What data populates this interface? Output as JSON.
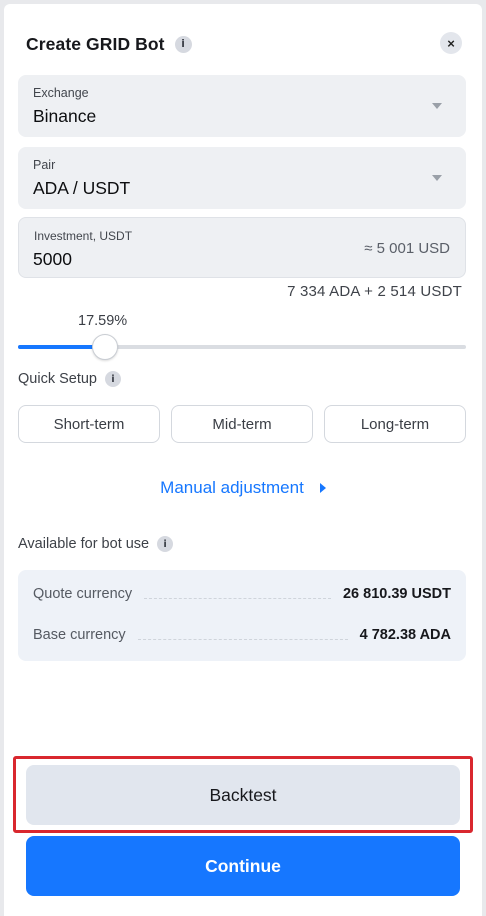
{
  "header": {
    "title": "Create GRID Bot",
    "info_glyph": "i",
    "close_glyph": "×"
  },
  "exchange": {
    "label": "Exchange",
    "value": "Binance"
  },
  "pair": {
    "label": "Pair",
    "value": "ADA / USDT"
  },
  "investment": {
    "label": "Investment, USDT",
    "value": "5000",
    "approx": "≈ 5 001 USD",
    "split": "7 334 ADA + 2 514 USDT"
  },
  "slider": {
    "percent_label": "17.59%",
    "fraction": 0.1759
  },
  "quick_setup": {
    "label": "Quick Setup",
    "info_glyph": "i",
    "options": [
      "Short-term",
      "Mid-term",
      "Long-term"
    ]
  },
  "manual": {
    "label": "Manual adjustment"
  },
  "available": {
    "label": "Available for bot use",
    "info_glyph": "i",
    "rows": [
      {
        "key": "Quote currency",
        "value": "26 810.39 USDT"
      },
      {
        "key": "Base currency",
        "value": "4 782.38 ADA"
      }
    ]
  },
  "actions": {
    "backtest": "Backtest",
    "continue": "Continue"
  },
  "colors": {
    "accent": "#1677ff",
    "highlight": "#d9272e"
  },
  "icons": {
    "info": "info-icon",
    "close": "close-icon",
    "dropdown": "chevron-down-icon",
    "expand": "play-triangle-icon"
  }
}
